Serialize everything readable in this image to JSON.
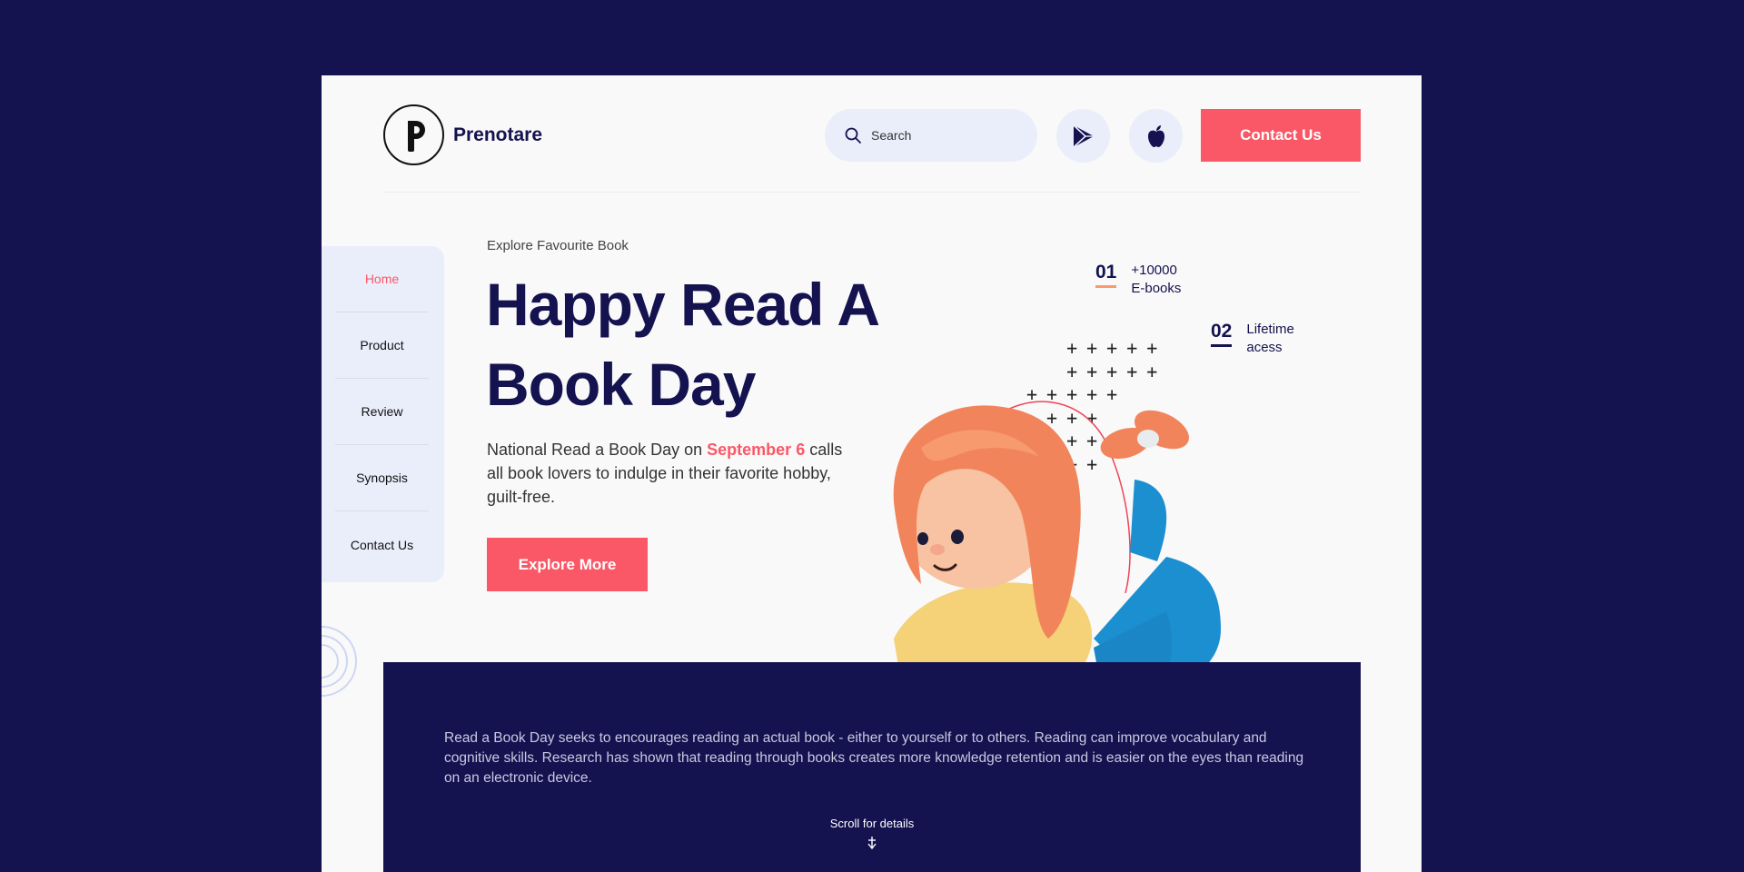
{
  "brand": {
    "name": "Prenotare"
  },
  "header": {
    "search_placeholder": "Search",
    "contact_label": "Contact Us"
  },
  "nav": {
    "items": [
      {
        "label": "Home",
        "active": true
      },
      {
        "label": "Product"
      },
      {
        "label": "Review"
      },
      {
        "label": "Synopsis"
      },
      {
        "label": "Contact Us"
      }
    ]
  },
  "hero": {
    "eyebrow": "Explore Favourite Book",
    "title": "Happy Read A Book Day",
    "desc_before": "National Read a Book Day on ",
    "desc_highlight": "September 6",
    "desc_after": " calls all book lovers to indulge in their favorite hobby, guilt-free.",
    "cta": "Explore More"
  },
  "stats": [
    {
      "num": "01",
      "line1": "+10000",
      "line2": "E-books"
    },
    {
      "num": "02",
      "line1": "Lifetime",
      "line2": "acess"
    }
  ],
  "panel": {
    "text": "Read a Book Day seeks to encourages reading an actual book - either to yourself or to others. Reading can improve vocabulary and cognitive skills. Research has shown that reading through books creates more knowledge retention and is easier on the eyes than reading on an electronic device.",
    "scroll": "Scroll for details"
  },
  "colors": {
    "accent": "#fa5867",
    "navy": "#14124f",
    "soft": "#eaeefb"
  },
  "icons": [
    "search-icon",
    "play-store-icon",
    "apple-icon",
    "arrow-down-icon"
  ]
}
